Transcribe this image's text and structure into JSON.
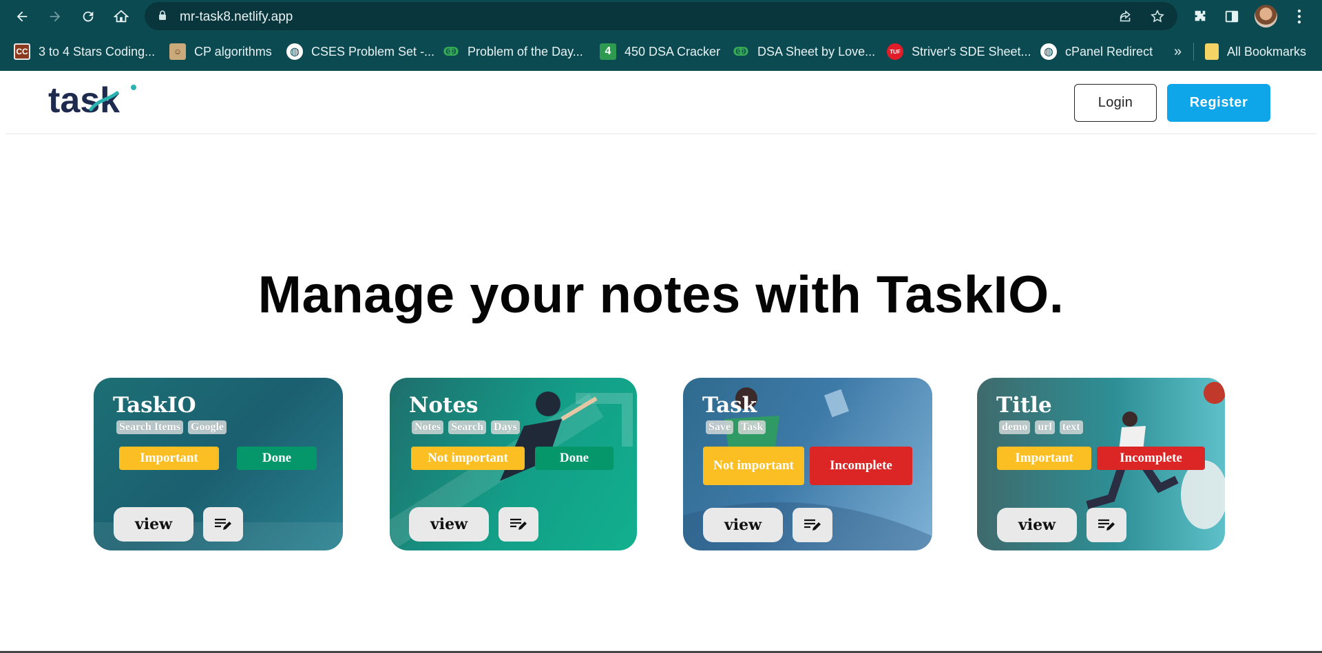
{
  "browser": {
    "url": "mr-task8.netlify.app",
    "bookmarks": [
      {
        "label": "3 to 4 Stars Coding...",
        "icon": "cc-icon",
        "color": "#8b3a1e",
        "glyph": "CC"
      },
      {
        "label": "CP algorithms",
        "icon": "cp-algorithms-icon",
        "color": "#6b5b3a",
        "glyph": "☺"
      },
      {
        "label": "CSES Problem Set -...",
        "icon": "globe-icon",
        "color": "#0c4a52",
        "glyph": "◍"
      },
      {
        "label": "Problem of the Day...",
        "icon": "gfg-icon",
        "color": "#0c4a52",
        "glyph": "ↂ"
      },
      {
        "label": "450 DSA Cracker",
        "icon": "450-icon",
        "color": "#2e9a4f",
        "glyph": "4"
      },
      {
        "label": "DSA Sheet by Love...",
        "icon": "gfg-icon",
        "color": "#0c4a52",
        "glyph": "ↂ"
      },
      {
        "label": "Striver's SDE Sheet...",
        "icon": "tuf-icon",
        "color": "#e11d2a",
        "glyph": "TUF"
      },
      {
        "label": "cPanel Redirect",
        "icon": "globe-icon",
        "color": "#0c4a52",
        "glyph": "◍"
      }
    ],
    "more_label": "»",
    "all_bookmarks": "All Bookmarks"
  },
  "header": {
    "logo_text": "task",
    "login_label": "Login",
    "register_label": "Register"
  },
  "hero": {
    "title": "Manage your notes with TaskIO."
  },
  "cards": [
    {
      "title": "TaskIO",
      "tags": [
        "Search Items",
        "Google"
      ],
      "priority": "Important",
      "status": "Done",
      "view_label": "view"
    },
    {
      "title": "Notes",
      "tags": [
        "Notes",
        "Search",
        "Days"
      ],
      "priority": "Not important",
      "status": "Done",
      "view_label": "view"
    },
    {
      "title": "Task",
      "tags": [
        "Save",
        "Task"
      ],
      "priority": "Not important",
      "status": "Incomplete",
      "view_label": "view"
    },
    {
      "title": "Title",
      "tags": [
        "demo",
        "url",
        "text"
      ],
      "priority": "Important",
      "status": "Incomplete",
      "view_label": "view"
    }
  ],
  "colors": {
    "chrome": "#0c4a52",
    "register": "#0ea5e9",
    "important": "#fbbf24",
    "done": "#059669",
    "incomplete": "#dc2626"
  }
}
